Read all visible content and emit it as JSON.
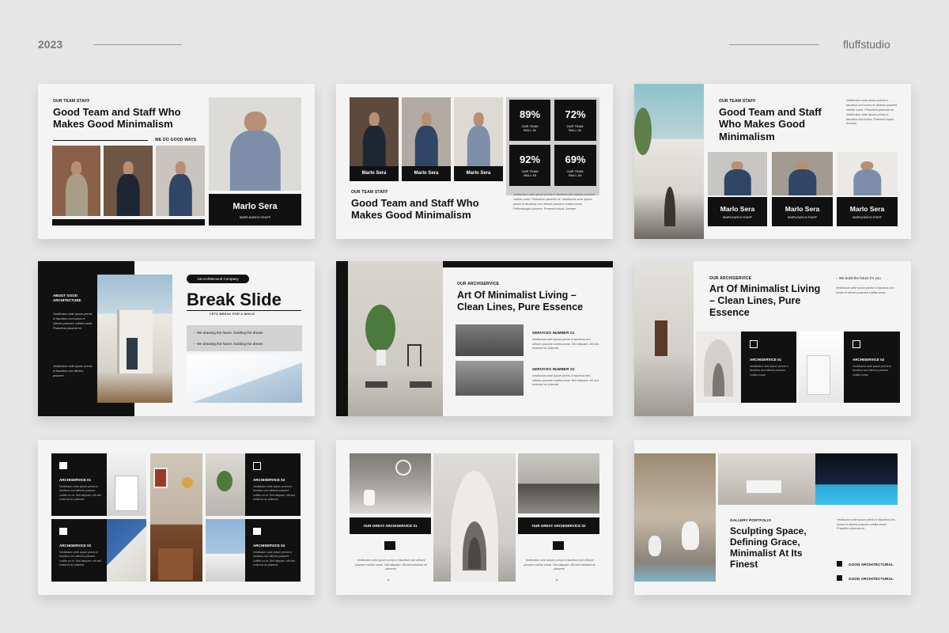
{
  "header": {
    "year": "2023",
    "brand": "fluffstudio"
  },
  "lorem_long": "Vestibulum ante ipsum primis in faucibus sed ultrices posuere cubilia cursus. Sed aliquam, elit sed euismod ac placerat risus porttitor congue, elit erat euismod orci.",
  "slide1": {
    "eyebrow": "OUR TEAM STAFF",
    "title": "Good Team and Staff Who Makes Good Minimalism",
    "tagline": "WE DO GOOD WAYS",
    "name": "Marlo Sera",
    "role": "SIMPLEARCH STAFF"
  },
  "slide2": {
    "names": [
      "Marlo Sera",
      "Marlo Sera",
      "Marlo Sera"
    ],
    "stats": [
      {
        "value": "89%",
        "label": "OUR TEAM SKILL 01"
      },
      {
        "value": "72%",
        "label": "OUR TEAM SKILL 02"
      },
      {
        "value": "92%",
        "label": "OUR TEAM SKILL 03"
      },
      {
        "value": "69%",
        "label": "OUR TEAM SKILL 04"
      }
    ],
    "eyebrow": "OUR TEAM STAFF",
    "title": "Good Team and Staff Who Makes Good Minimalism",
    "body": "Vestibulum ante ipsum primis in faucibus sed ultrices posuere cubilia curae. Phasellus placerat mi. Vestibulum ante ipsum primis in faucibus orci ultrices posuere cubilia curae. Pellentesque posuere. Praesent turpis. Aenean"
  },
  "slide3": {
    "eyebrow": "OUR TEAM STAFF",
    "title": "Good Team and Staff Who Makes Good Minimalism",
    "side_text": "Vestibulum ante ipsum primis in faucibus orci luctus et ultrices posuere cubilia curae. Phasellus placerat mi. Vestibulum ante ipsum primis in faucibus orci luctus. Praesent turpis. Aenean",
    "members": [
      {
        "name": "Marlo Sera",
        "role": "SIMPLEARCH STAFF"
      },
      {
        "name": "Marlo Sera",
        "role": "SIMPLEARCH STAFF"
      },
      {
        "name": "Marlo Sera",
        "role": "SIMPLEARCH STAFF"
      }
    ]
  },
  "slide4": {
    "about": "ABOUT GOOD ARCHITECTURE",
    "text1": "Vestibulum ante ipsum primis in faucibus orci luctus et ultrices posuere cubilia curae. Phasellus placerat mi.",
    "text2": "Vestibulum ante ipsum primis in faucibus orci ultrices posuere.",
    "badge": "1st Architectural Company",
    "title": "Break Slide",
    "sub": "LETS BREAK FOR A WHILE",
    "bullets": [
      "We drawing the future, building the dream",
      "We drawing the future, building the dream"
    ]
  },
  "slide5": {
    "eyebrow": "OUR ARCHISERVICE",
    "title": "Art Of Minimalist Living – Clean Lines, Pure Essence",
    "services": [
      {
        "label": "SERVICES NUMBER 01",
        "text": "Vestibulum ante ipsum primis in faucibus sed ultrices posuere cubilia curae. Sed aliquam, elit sed euismod ac placerat."
      },
      {
        "label": "SERVICES NUMBER 02",
        "text": "Vestibulum ante ipsum primis in faucibus sed ultrices posuere cubilia curae. Sed aliquam, elit sed euismod ac placerat."
      }
    ]
  },
  "slide6": {
    "eyebrow": "OUR ARCHISERVICE",
    "title": "Art Of Minimalist Living – Clean Lines, Pure Essence",
    "bullet": "We build the future for you",
    "side_text": "Vestibulum ante ipsum primis in faucibus orci luctus et ultrices posuere cubilia curae.",
    "cards": [
      {
        "label": "ARCHISERVICE 01",
        "text": "Vestibulum ante ipsum primis in faucibus sed ultrices posuere cubilia curae."
      },
      {
        "label": "ARCHISERVICE 02",
        "text": "Vestibulum ante ipsum primis in faucibus sed ultrices posuere cubilia curae."
      }
    ]
  },
  "slide7": {
    "cards": [
      {
        "label": "ARCHISERVICE 01",
        "text": "Vestibulum ante ipsum primis in faucibus orci ultrices posuere cubilia cu ra. Sed aliquam, elit sed euismod ac placerat."
      },
      {
        "label": "ARCHISERVICE 02",
        "text": "Vestibulum ante ipsum primis in faucibus orci ultrices posuere cubilia cu ra. Sed aliquam, elit sed euismod ac placerat."
      },
      {
        "label": "ARCHISERVICE 03",
        "text": "Vestibulum ante ipsum primis in faucibus orci ultrices posuere cubilia cu ra. Sed aliquam, elit sed euismod ac placerat."
      },
      {
        "label": "ARCHISERVICE 04",
        "text": "Vestibulum ante ipsum primis in faucibus orci ultrices posuere cubilia cu ra. Sed aliquam, elit sed euismod ac placerat."
      }
    ]
  },
  "slide8": {
    "labels": [
      "OUR GREAT ARCHISERVICE 01",
      "OUR GREAT ARCHISERVICE 02"
    ],
    "texts": [
      "Vestibulum ante ipsum primis in faucibus sed ultrices posuere cubilia curae. Sed aliquam, elit sed euismod ac placerat.",
      "Vestibulum ante ipsum primis in faucibus sed ultrices posuere cubilia curae. Sed aliquam, elit sed euismod ac placerat."
    ]
  },
  "slide9": {
    "eyebrow": "GALLERY PORTFOLIO",
    "title": "Sculpting Space, Defining Grace, Minimalist At Its Finest",
    "side_text": "Vestibulum ante ipsum primis in faucibus orci luctus et ultrices posuere cubilia curae. Phasellus placerat mi.",
    "items": [
      "GOOD ARCHITECTURAL",
      "GOOD ARCHITECTURAL"
    ]
  }
}
